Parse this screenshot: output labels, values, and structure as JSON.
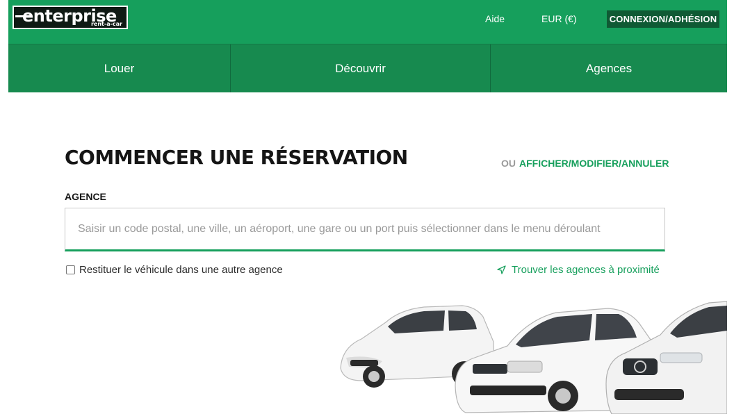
{
  "header": {
    "logo": {
      "main": "enterprise",
      "sub": "rent-a-car"
    },
    "help_label": "Aide",
    "currency_label": "EUR (€)",
    "login_label": "CONNEXION/ADHÉSION"
  },
  "nav": {
    "items": [
      {
        "label": "Louer"
      },
      {
        "label": "Découvrir"
      },
      {
        "label": "Agences"
      }
    ]
  },
  "reservation": {
    "title": "COMMENCER UNE RÉSERVATION",
    "or_label": "OU",
    "manage_link": "AFFICHER/MODIFIER/ANNULER",
    "location_label": "AGENCE",
    "location_placeholder": "Saisir un code postal, une ville, un aéroport, une gare ou un port puis sélectionner dans le menu déroulant",
    "return_elsewhere_label": "Restituer le véhicule dans une autre agence",
    "nearby_link": "Trouver les agences à proximité"
  },
  "colors": {
    "brand_green": "#169f5c",
    "nav_green": "#178a4f",
    "button_dark": "#0f5a34"
  },
  "icons": {
    "nearby": "location-arrow-icon",
    "cars": "cars-illustration"
  }
}
